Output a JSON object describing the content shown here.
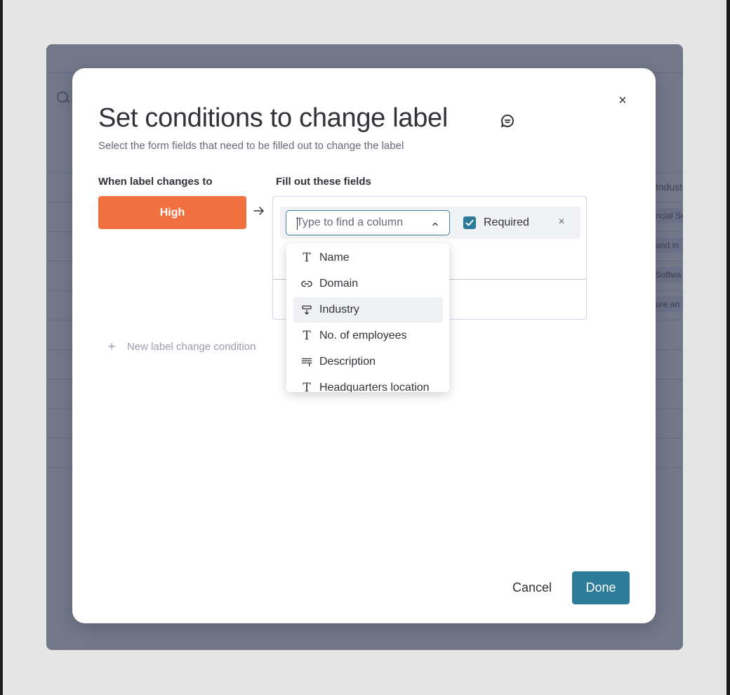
{
  "background": {
    "column_header": "Indust",
    "column_cells": [
      "ncial Se",
      "and In",
      "Softwa",
      "ure an"
    ]
  },
  "modal": {
    "title": "Set conditions to change label",
    "subtitle": "Select the form fields that need to be filled out to change the label",
    "close_label": "×",
    "when_label_heading": "When label changes to",
    "fill_fields_heading": "Fill out these fields",
    "label_value": "High",
    "label_color": "#f0703f",
    "column_search": {
      "placeholder": "Type to find a column",
      "value": ""
    },
    "required_label": "Required",
    "required_checked": true,
    "remove_label": "×",
    "new_condition_label": "New label change condition",
    "new_condition_plus": "+",
    "dropdown": {
      "items": [
        {
          "label": "Name",
          "icon": "text-icon",
          "glyph": "T"
        },
        {
          "label": "Domain",
          "icon": "link-icon"
        },
        {
          "label": "Industry",
          "icon": "dropdown-column-icon",
          "active": true
        },
        {
          "label": "No. of employees",
          "icon": "text-icon",
          "glyph": "T"
        },
        {
          "label": "Description",
          "icon": "long-text-icon"
        },
        {
          "label": "Headquarters location",
          "icon": "text-icon",
          "glyph": "T"
        }
      ]
    },
    "cancel_label": "Cancel",
    "done_label": "Done",
    "accent_color": "#2d7d9a"
  }
}
